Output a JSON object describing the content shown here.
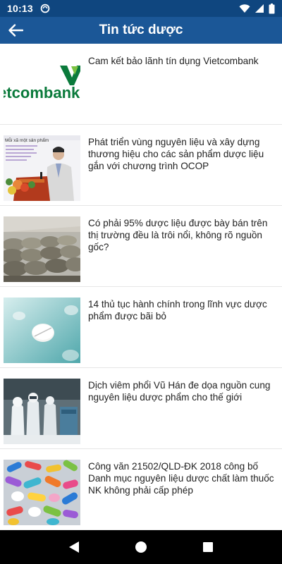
{
  "status_bar": {
    "time": "10:13"
  },
  "app_bar": {
    "title": "Tin tức dược",
    "back_icon": "arrow-left-icon"
  },
  "news": [
    {
      "title": "Cam kết bảo lãnh tín dụng Vietcombank",
      "thumb_text": "ietcombank"
    },
    {
      "title": "Phát triển vùng nguyên liệu và xây dựng thương hiệu cho các sản phẩm dược liệu gắn với chương trình OCOP",
      "thumb_text": "Mỗi xã một sản phẩm"
    },
    {
      "title": "Có phải 95% dược liệu được bày bán trên thị trường đều là trôi nổi, không rõ nguồn gốc?"
    },
    {
      "title": "14 thủ tục hành chính trong lĩnh vực dược phẩm được bãi bỏ"
    },
    {
      "title": "Dịch viêm phổi Vũ Hán đe dọa nguồn cung nguyên liệu dược phẩm cho thế giới"
    },
    {
      "title": "Công văn 21502/QLD-ĐK 2018 công bố Danh mục nguyên liệu dược chất làm thuốc NK không phải cấp phép"
    }
  ],
  "colors": {
    "status_bar": "#0f467f",
    "app_bar": "#1b5797",
    "vietcombank_green": "#0a7a3b"
  }
}
